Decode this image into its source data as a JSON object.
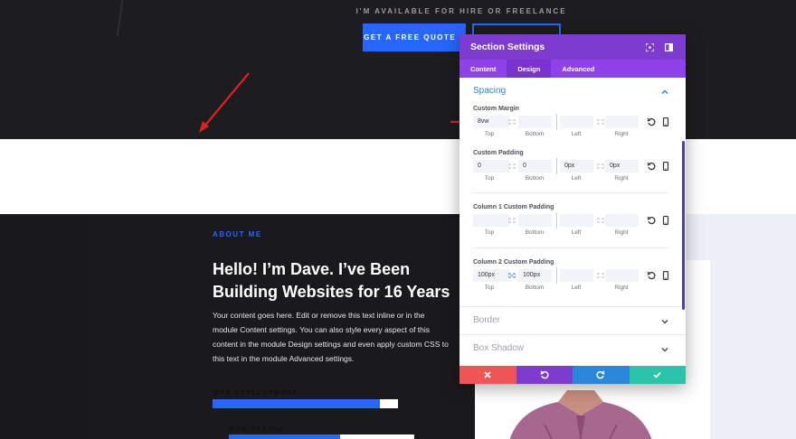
{
  "page": {
    "availability_text": "I'M AVAILABLE FOR HIRE OR FREELANCE",
    "quote_button": "GET A FREE QUOTE »",
    "about_label": "ABOUT ME",
    "about_heading": "Hello! I’m Dave. I’ve Been Building Websites for 16 Years",
    "about_body": "Your content goes here. Edit or remove this text inline or in the module Content settings. You can also style every aspect of this content in the module Design settings and even apply custom CSS to this text in the module Advanced settings.",
    "skills": [
      {
        "label": "WEB DEVELOPMENT",
        "fill": 0.9
      },
      {
        "label": "WEB DESIGN",
        "fill": 0.6
      }
    ]
  },
  "modal": {
    "title": "Section Settings",
    "tabs": [
      "Content",
      "Design",
      "Advanced"
    ],
    "active_tab": "Design",
    "spacing_title": "Spacing",
    "groups": [
      {
        "label": "Custom Margin",
        "values": [
          "8vw",
          "",
          "",
          ""
        ],
        "linked": false
      },
      {
        "label": "Custom Padding",
        "values": [
          "0",
          "0",
          "0px",
          "0px"
        ],
        "linked": false
      },
      {
        "label": "Column 1 Custom Padding",
        "values": [
          "",
          "",
          "",
          ""
        ],
        "linked": false
      },
      {
        "label": "Column 2 Custom Padding",
        "values": [
          "100px",
          "100px",
          "",
          ""
        ],
        "linked": true
      }
    ],
    "sub_labels": [
      "Top",
      "Bottom",
      "Left",
      "Right"
    ],
    "collapsed_sections": [
      "Border",
      "Box Shadow"
    ]
  },
  "colors": {
    "accent_blue": "#2667ff",
    "modal_header": "#7e3bd0",
    "modal_tabs": "#8f42ec",
    "spacing_blue": "#2b87da",
    "cancel_red": "#ef5555",
    "undo_purple": "#7e3bd0",
    "redo_blue": "#2b87da",
    "save_green": "#29c4a9"
  }
}
